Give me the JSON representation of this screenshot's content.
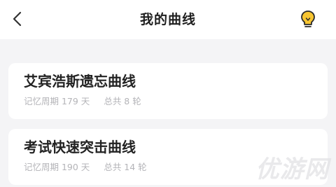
{
  "header": {
    "title": "我的曲线",
    "back_icon": "chevron-left-icon",
    "tip_icon": "lightbulb-icon"
  },
  "curves": [
    {
      "title": "艾宾浩斯遗忘曲线",
      "cycle": "记忆周期 179 天",
      "rounds": "总共 8 轮"
    },
    {
      "title": "考试快速突击曲线",
      "cycle": "记忆周期 190 天",
      "rounds": "总共 14 轮"
    }
  ],
  "colors": {
    "background": "#f4f4f6",
    "card": "#ffffff",
    "title_text": "#222222",
    "meta_text": "#b4b4b8",
    "bulb_accent": "#f7c531"
  },
  "watermark": {
    "text": "优游网"
  }
}
